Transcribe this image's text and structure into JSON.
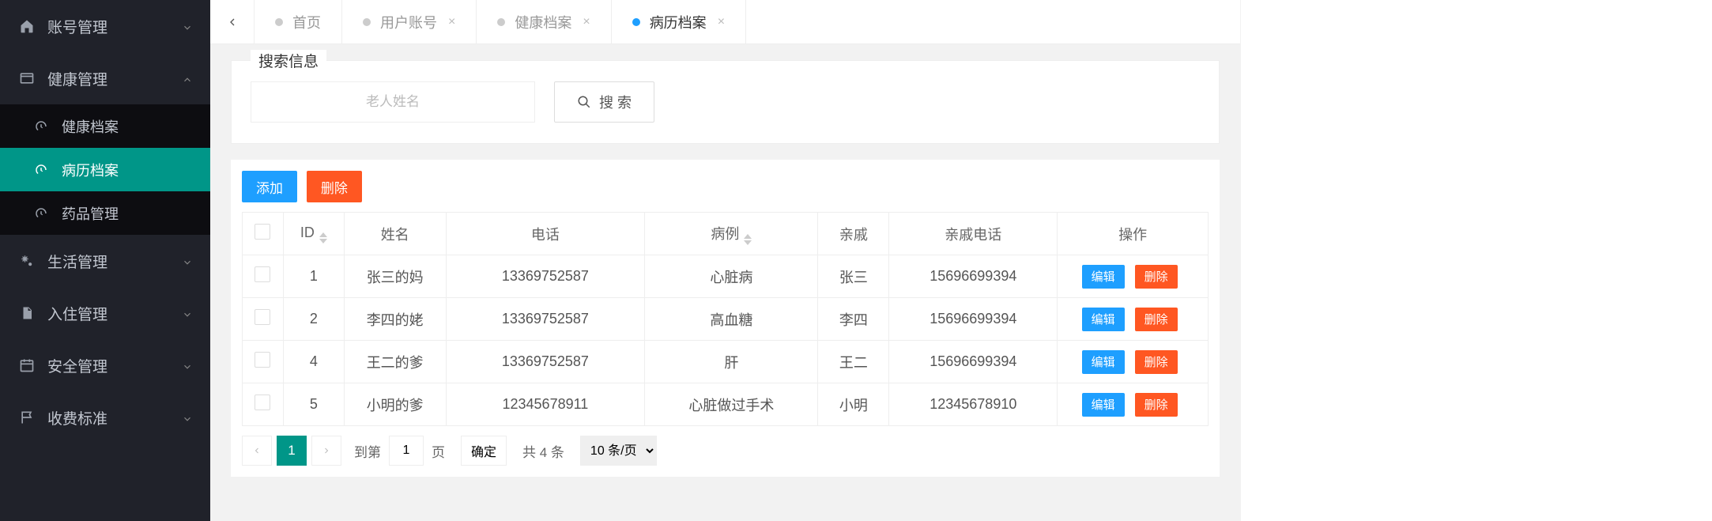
{
  "sidebar": {
    "items": [
      {
        "label": "账号管理",
        "expanded": false
      },
      {
        "label": "健康管理",
        "expanded": true,
        "children": [
          {
            "label": "健康档案",
            "active": false
          },
          {
            "label": "病历档案",
            "active": true
          },
          {
            "label": "药品管理",
            "active": false
          }
        ]
      },
      {
        "label": "生活管理",
        "expanded": false
      },
      {
        "label": "入住管理",
        "expanded": false
      },
      {
        "label": "安全管理",
        "expanded": false
      },
      {
        "label": "收费标准",
        "expanded": false
      }
    ]
  },
  "tabs": [
    {
      "label": "首页",
      "active": false,
      "closable": false
    },
    {
      "label": "用户账号",
      "active": false,
      "closable": true
    },
    {
      "label": "健康档案",
      "active": false,
      "closable": true
    },
    {
      "label": "病历档案",
      "active": true,
      "closable": true
    }
  ],
  "search": {
    "legend": "搜索信息",
    "placeholder": "老人姓名",
    "button": "搜 索"
  },
  "toolbar": {
    "add": "添加",
    "delete": "删除"
  },
  "columns": {
    "id": "ID",
    "name": "姓名",
    "phone": "电话",
    "case": "病例",
    "relative": "亲戚",
    "relativePhone": "亲戚电话",
    "ops": "操作"
  },
  "rows": [
    {
      "id": "1",
      "name": "张三的妈",
      "phone": "13369752587",
      "case": "心脏病",
      "relative": "张三",
      "relativePhone": "15696699394"
    },
    {
      "id": "2",
      "name": "李四的姥",
      "phone": "13369752587",
      "case": "高血糖",
      "relative": "李四",
      "relativePhone": "15696699394"
    },
    {
      "id": "4",
      "name": "王二的爹",
      "phone": "13369752587",
      "case": "肝",
      "relative": "王二",
      "relativePhone": "15696699394"
    },
    {
      "id": "5",
      "name": "小明的爹",
      "phone": "12345678911",
      "case": "心脏做过手术",
      "relative": "小明",
      "relativePhone": "12345678910"
    }
  ],
  "rowOps": {
    "edit": "编辑",
    "delete": "删除"
  },
  "pager": {
    "current": "1",
    "gotoLabel": "到第",
    "gotoValue": "1",
    "pageUnit": "页",
    "confirm": "确定",
    "total": "共 4 条",
    "perPage": "10 条/页"
  }
}
